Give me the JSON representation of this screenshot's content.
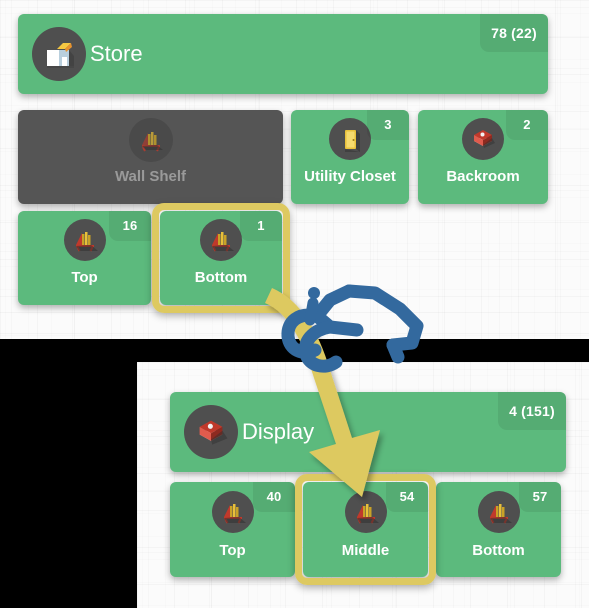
{
  "meta": {
    "green": "#5cba7d",
    "gray": "#555555",
    "highlight_yellow": "#ddc961",
    "hand_blue": "#33699e",
    "icon_circle_gray": "#4f4f4f"
  },
  "top_panel": {
    "header": {
      "title": "Store",
      "badge": "78 (22)",
      "icon": "store-building-icon"
    },
    "row1": [
      {
        "label": "Wall Shelf",
        "badge": "",
        "icon": "shelf-icon",
        "state": "disabled",
        "selected": false
      },
      {
        "label": "Utility Closet",
        "badge": "3",
        "icon": "door-icon",
        "state": "normal",
        "selected": false
      },
      {
        "label": "Backroom",
        "badge": "2",
        "icon": "open-box-icon",
        "state": "normal",
        "selected": false
      }
    ],
    "row2": [
      {
        "label": "Top",
        "badge": "16",
        "icon": "shelf-icon",
        "state": "normal",
        "selected": false
      },
      {
        "label": "Bottom",
        "badge": "1",
        "icon": "shelf-icon",
        "state": "normal",
        "selected": true
      }
    ]
  },
  "bottom_panel": {
    "header": {
      "title": "Display",
      "badge": "4 (151)",
      "icon": "open-box-icon"
    },
    "row1": [
      {
        "label": "Top",
        "badge": "40",
        "icon": "shelf-icon",
        "state": "normal",
        "selected": false
      },
      {
        "label": "Middle",
        "badge": "54",
        "icon": "shelf-icon",
        "state": "normal",
        "selected": true
      },
      {
        "label": "Bottom",
        "badge": "57",
        "icon": "shelf-icon",
        "state": "normal",
        "selected": false
      }
    ]
  },
  "annotations": {
    "arrow": "yellow-down-arrow",
    "cursor": "blue-hand-pointer-icon"
  }
}
